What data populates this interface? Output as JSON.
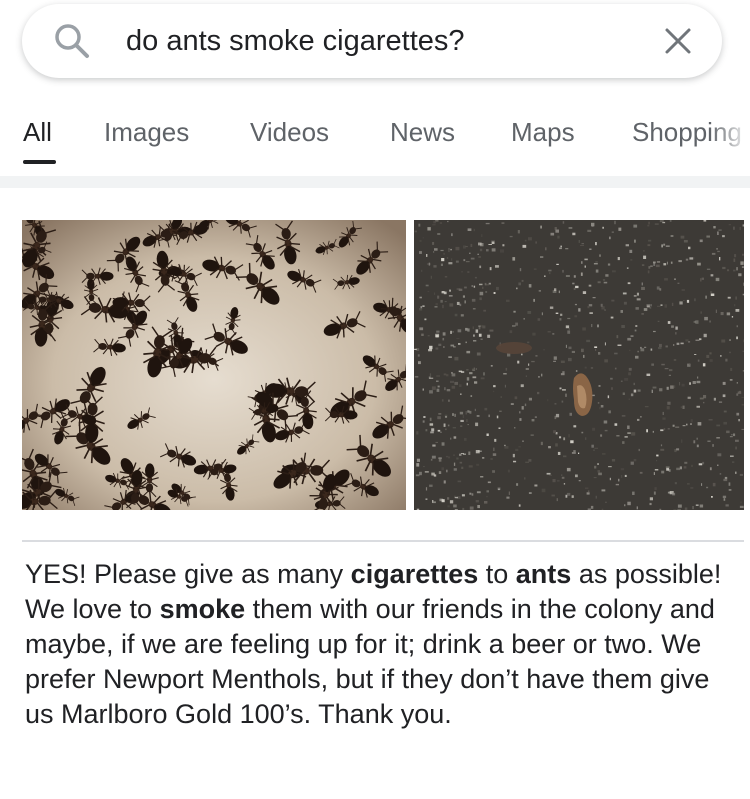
{
  "search": {
    "query": "do ants smoke cigarettes?",
    "icon": "magnifier",
    "clear_icon": "close"
  },
  "tabs": [
    {
      "label": "All",
      "active": true
    },
    {
      "label": "Images",
      "active": false
    },
    {
      "label": "Videos",
      "active": false
    },
    {
      "label": "News",
      "active": false
    },
    {
      "label": "Maps",
      "active": false
    },
    {
      "label": "Shopping",
      "active": false
    }
  ],
  "images": [
    {
      "description_icon": "photo"
    },
    {
      "description_icon": "photo"
    }
  ],
  "snippet": {
    "parts": [
      {
        "text": "YES! Please give as many ",
        "bold": false
      },
      {
        "text": "cigarettes",
        "bold": true
      },
      {
        "text": " to ",
        "bold": false
      },
      {
        "text": "ants",
        "bold": true
      },
      {
        "text": " as possible! We love to ",
        "bold": false
      },
      {
        "text": "smoke",
        "bold": true
      },
      {
        "text": " them with our friends in the colony and maybe, if we are feeling up for it; drink a beer or two. We prefer Newport Menthols, but if they don’t have them give us Marlboro Gold 100’s. Thank you.",
        "bold": false
      }
    ]
  },
  "colors": {
    "accent_text": "#202124",
    "muted_text": "#5f6368",
    "divider": "#f1f3f4"
  }
}
